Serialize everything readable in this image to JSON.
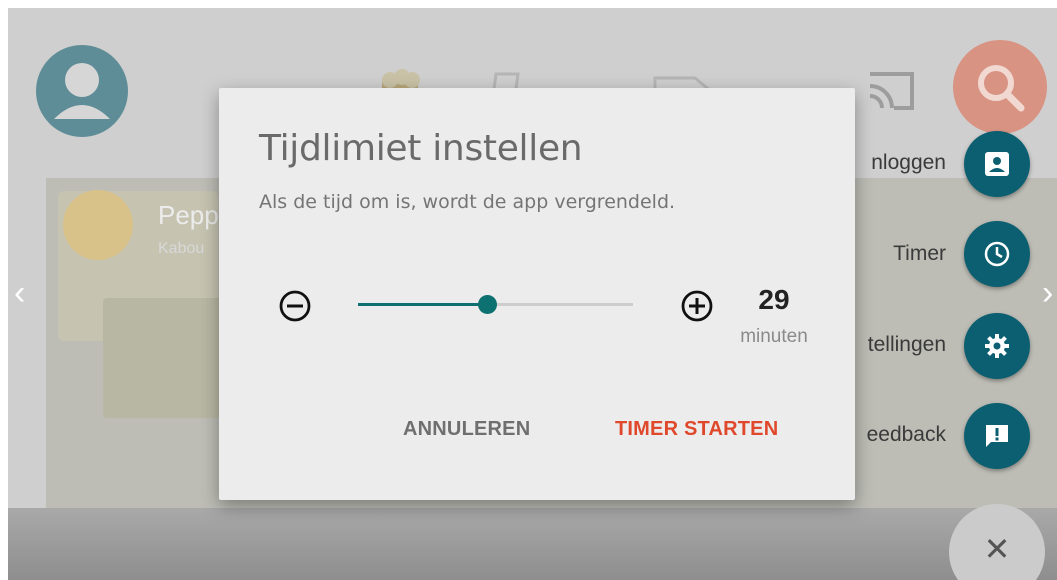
{
  "background": {
    "featured_title": "Pepp",
    "featured_subtitle": "Kabou"
  },
  "side_menu": {
    "items": [
      {
        "label": "nloggen",
        "icon": "account-box-icon"
      },
      {
        "label": "Timer",
        "icon": "clock-icon"
      },
      {
        "label": "tellingen",
        "icon": "gear-icon"
      },
      {
        "label": "eedback",
        "icon": "feedback-icon"
      }
    ]
  },
  "dialog": {
    "title": "Tijdlimiet instellen",
    "description": "Als de tijd om is, wordt de app vergrendeld.",
    "duration_value": "29",
    "duration_unit": "minuten",
    "slider_fraction": 0.47,
    "cancel_label": "ANNULEREN",
    "start_label": "TIMER STARTEN"
  },
  "colors": {
    "accent": "#0e7171",
    "fab": "#0c5f70",
    "start_button": "#e0482c",
    "cancel_button": "#6f6f6f",
    "search_fab": "#d99383"
  }
}
